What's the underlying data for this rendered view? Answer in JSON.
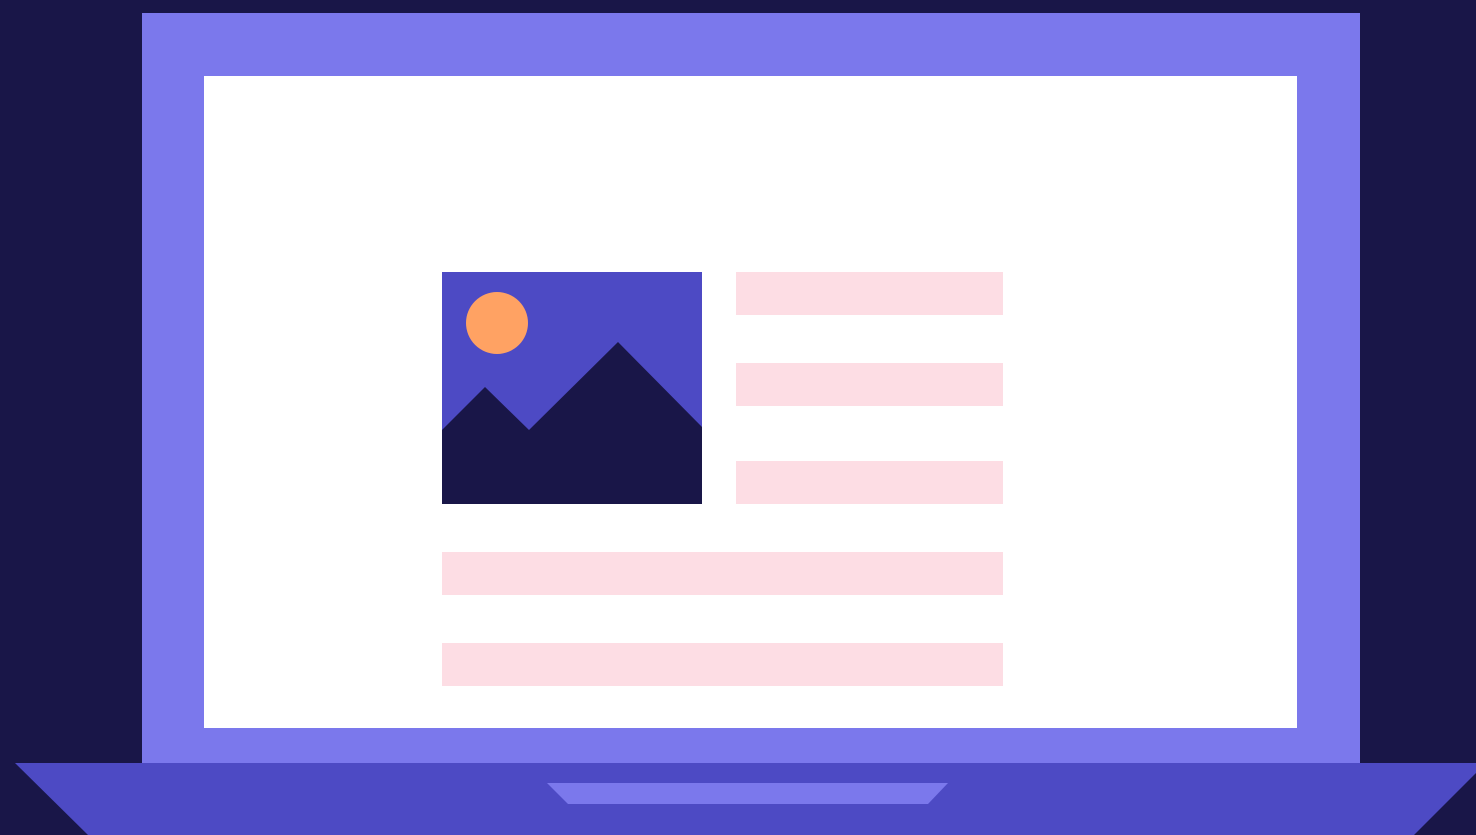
{
  "colors": {
    "background": "#191648",
    "lid": "#7b78ec",
    "screen": "#ffffff",
    "base": "#4d4ac4",
    "trackpad": "#7b78ec",
    "dot_red": "#ff4477",
    "dot_orange": "#ffab6d",
    "dot_blue": "#4d4ac4",
    "image_sky": "#4d4ac4",
    "image_sun": "#ffa263",
    "image_mountains": "#191648",
    "text_placeholder": "#fddde4"
  },
  "icons": {
    "window_controls": [
      "close-dot",
      "minimize-dot",
      "maximize-dot"
    ],
    "image": "image-placeholder-icon"
  }
}
